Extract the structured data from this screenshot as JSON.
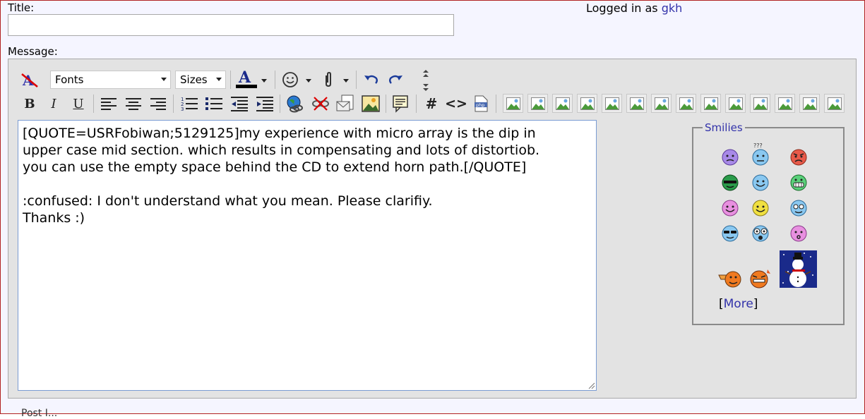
{
  "form": {
    "title_label": "Title:",
    "title_value": "",
    "message_label": "Message:",
    "logged_in_prefix": "Logged in as ",
    "username": "gkh"
  },
  "toolbar": {
    "font_select": "Fonts",
    "size_select": "Sizes"
  },
  "editor": {
    "message_text": "[QUOTE=USRFobiwan;5129125]my experience with micro array is the dip in\nupper case mid section. which results in compensating and lots of distortiob.\nyou can use the empty space behind the CD to extend horn path.[/QUOTE]\n\n:confused: I don't understand what you mean. Please clarifiy.\nThanks :)"
  },
  "smilies": {
    "legend": "Smilies",
    "more_open": "[",
    "more_label": "More",
    "more_close": "]",
    "items": [
      "confused-smiley",
      "question-smiley",
      "mad-smiley",
      "green-smiley",
      "blue-smiley",
      "grin-smiley",
      "pink-smiley",
      "happy-smiley",
      "cool-blue-smiley",
      "sunglasses-smiley",
      "eek-smiley",
      "kiss-smiley",
      "pointing-smiley",
      "devil-smiley",
      "snowman-smiley"
    ]
  },
  "colors": {
    "accent": "#3333aa",
    "border": "#b22222",
    "toolbar_bg": "#e3e3e3"
  },
  "footer": {
    "cut_text": "Post I..."
  }
}
